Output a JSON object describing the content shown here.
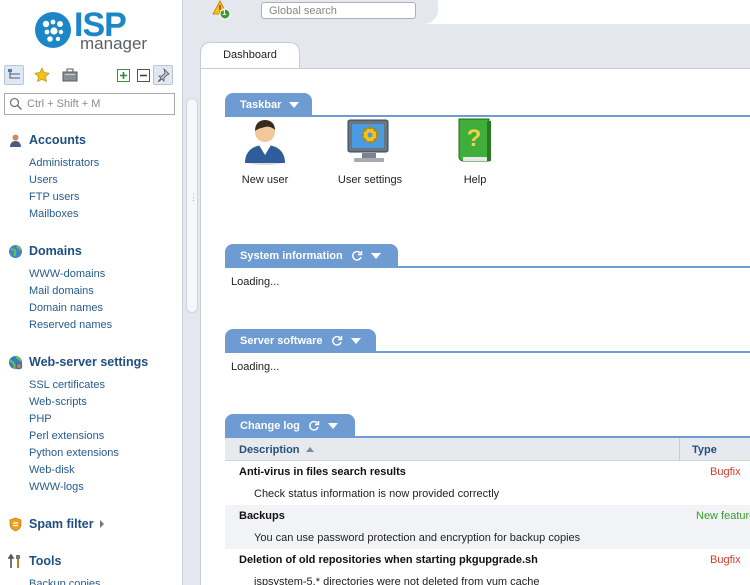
{
  "brand": {
    "logo_text": "ISP",
    "logo_sub": "manager"
  },
  "sidebar": {
    "search_placeholder": "Ctrl + Shift + M",
    "sections": [
      {
        "title": "Accounts",
        "items": [
          "Administrators",
          "Users",
          "FTP users",
          "Mailboxes"
        ]
      },
      {
        "title": "Domains",
        "items": [
          "WWW-domains",
          "Mail domains",
          "Domain names",
          "Reserved names"
        ]
      },
      {
        "title": "Web-server settings",
        "items": [
          "SSL certificates",
          "Web-scripts",
          "PHP",
          "Perl extensions",
          "Python extensions",
          "Web-disk",
          "WWW-logs"
        ]
      },
      {
        "title": "Spam filter",
        "items": []
      },
      {
        "title": "Tools",
        "items": [
          "Backup copies"
        ]
      }
    ]
  },
  "topbar": {
    "alert_count": "1",
    "search_placeholder": "Global search"
  },
  "tabs": [
    {
      "label": "Dashboard"
    }
  ],
  "panels": {
    "taskbar": {
      "title": "Taskbar",
      "items": [
        {
          "label": "New user"
        },
        {
          "label": "User settings"
        },
        {
          "label": "Help"
        }
      ]
    },
    "sysinfo": {
      "title": "System information",
      "body": "Loading..."
    },
    "software": {
      "title": "Server software",
      "body": "Loading..."
    },
    "changelog": {
      "title": "Change log",
      "columns": [
        "Description",
        "Type"
      ],
      "rows": [
        {
          "title": "Anti-virus in files search results",
          "desc": "Check status information is now provided correctly",
          "type": "Bugfix"
        },
        {
          "title": "Backups",
          "desc": "You can use password protection and encryption for backup copies",
          "type": "New feature"
        },
        {
          "title": "Deletion of old repositories when starting pkgupgrade.sh",
          "desc": "ispsystem-5.* directories were not deleted from yum cache",
          "type": "Bugfix"
        }
      ]
    }
  },
  "colors": {
    "accent": "#6e9bd1",
    "link": "#275c8e",
    "bugfix": "#d23a2c",
    "feature": "#3d9a2f",
    "brand": "#1b87c9"
  }
}
